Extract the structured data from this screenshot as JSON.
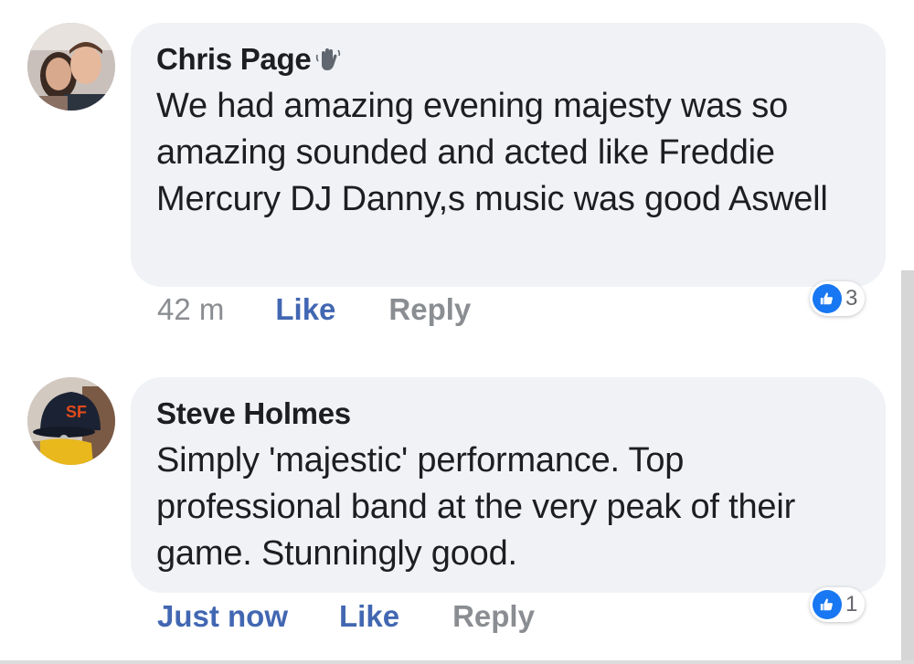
{
  "comments": [
    {
      "author": "Chris Page",
      "text": "We had amazing evening majesty was so amazing sounded and acted like Freddie Mercury DJ Danny,s music was good Aswell",
      "timestamp": "42 m",
      "like_label": "Like",
      "reply_label": "Reply",
      "reaction_count": "3",
      "author_icon": "wave-icon"
    },
    {
      "author": "Steve Holmes",
      "text": "Simply 'majestic' performance. Top professional band at the very peak of their game. Stunningly good.",
      "timestamp": "Just now",
      "like_label": "Like",
      "reply_label": "Reply",
      "reaction_count": "1"
    }
  ],
  "colors": {
    "bubble": "#f0f2f5",
    "link": "#4267b2",
    "muted": "#8a8d91",
    "reaction": "#1877f2"
  }
}
